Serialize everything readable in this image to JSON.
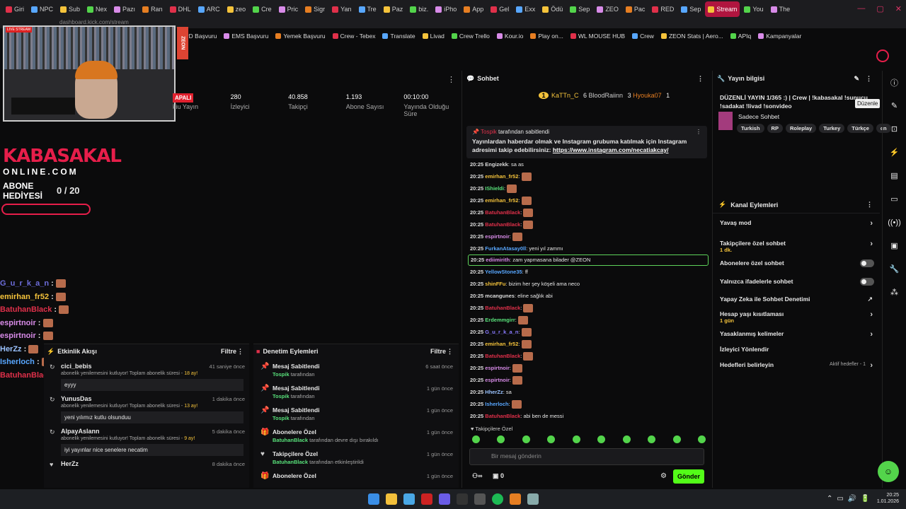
{
  "browser": {
    "tabs": [
      "Giri",
      "NPC",
      "Sub",
      "Nex",
      "Pazı",
      "Ran",
      "DHL",
      "ARC",
      "zeo",
      "Cre",
      "Pric",
      "Sigr",
      "Yan",
      "Tre",
      "Paz",
      "biz.",
      "iPho",
      "App",
      "Gel",
      "Exx",
      "Ödü",
      "Sep",
      "ZEO",
      "Pac",
      "RED",
      "Sep",
      "Stream",
      "You",
      "The"
    ],
    "active_tab": "Stream",
    "url": "dashboard.kick.com/stream"
  },
  "bookmarks": [
    "PD Başvuru",
    "EMS Başvuru",
    "Yemek Başvuru",
    "Crew - Tebex",
    "Translate",
    "Livad",
    "Crew Trello",
    "Kour.io",
    "Play on...",
    "WL MOUSE HUB",
    "Crew",
    "ZEON Stats | Aero...",
    "APIq",
    "Kampanyalar"
  ],
  "overlay": {
    "live_badge": "LIVE STREAM",
    "z_tag": "ZEON",
    "brand": "KABASAKAL",
    "brand_sub": "ONLINE.COM",
    "sub_goal_label": "ABONE HEDİYESİ",
    "sub_goal": "0 / 20",
    "sub_goal_fraction": 0,
    "chat": [
      {
        "user": "G_u_r_k_a_n",
        "color": "#6d6ddc"
      },
      {
        "user": "emirhan_fr52",
        "color": "#f5c33b"
      },
      {
        "user": "BatuhanBlack",
        "color": "#e0304a"
      },
      {
        "user": "espirtnoir",
        "color": "#d88be8"
      },
      {
        "user": "espirtnoir",
        "color": "#d88be8"
      },
      {
        "user": "HerZz",
        "color": "#9bc3ff"
      },
      {
        "user": "Isherloch",
        "color": "#58a7ff"
      },
      {
        "user": "BatuhanBlack",
        "color": "#e0304a"
      }
    ],
    "chat_msg": "abi ben de messi"
  },
  "stats": {
    "live": "APALI",
    "items": [
      {
        "v": "",
        "l": "kiu Yayın"
      },
      {
        "v": "280",
        "l": "İzleyici"
      },
      {
        "v": "40.858",
        "l": "Takipçi"
      },
      {
        "v": "1.193",
        "l": "Abone Sayısı"
      },
      {
        "v": "00:10:00",
        "l": "Yayında Olduğu Süre"
      }
    ]
  },
  "activity": {
    "title": "Etkinlik Akışı",
    "filter": "Filtre",
    "items": [
      {
        "name": "cici_bebis",
        "time": "41 saniye önce",
        "desc": "abonelik yenilemesini kutluyor! Toplam abonelik süresi - ",
        "months": "18 ay!",
        "msg": "eyyy"
      },
      {
        "name": "YunusDas",
        "time": "1 dakika önce",
        "desc": "abonelik yenilemesini kutluyor! Toplam abonelik süresi - ",
        "months": "13 ay!",
        "msg": "yeni yılımız kutlu olsunduu"
      },
      {
        "name": "AlpayAslann",
        "time": "5 dakika önce",
        "desc": "abonelik yenilemesini kutluyor! Toplam abonelik süresi - ",
        "months": "9 ay!",
        "msg": "iyi yayınlar nice senelere necatim"
      },
      {
        "name": "HerZz",
        "time": "8 dakika önce",
        "desc": "",
        "months": "",
        "msg": ""
      }
    ]
  },
  "moderation": {
    "title": "Denetim Eylemleri",
    "filter": "Filtre",
    "items": [
      {
        "name": "Mesaj Sabitlendi",
        "user": "Tospik",
        "rest": " tarafından",
        "time": "6 saat önce"
      },
      {
        "name": "Mesaj Sabitlendi",
        "user": "Tospik",
        "rest": " tarafından",
        "time": "1 gün önce"
      },
      {
        "name": "Mesaj Sabitlendi",
        "user": "Tospik",
        "rest": " tarafından",
        "time": "1 gün önce"
      },
      {
        "name": "Abonelere Özel",
        "user": "BatuhanBlack",
        "rest": " tarafından devre dışı bırakıldı",
        "time": "1 gün önce"
      },
      {
        "name": "Takipçilere Özel",
        "user": "BatuhanBlack",
        "rest": " tarafından etkinleştirildi",
        "time": "1 gün önce"
      },
      {
        "name": "Abonelere Özel",
        "user": "",
        "rest": "",
        "time": "1 gün önce"
      }
    ]
  },
  "chat": {
    "title": "Sohbet",
    "leaders": [
      {
        "name": "KaTTn_C",
        "n": "6"
      },
      {
        "name": "BloodRaiinn",
        "n": "3"
      },
      {
        "name": "Hyouka07",
        "n": "1"
      }
    ],
    "rank": "1",
    "pinned_by": "Tospik",
    "pinned_suffix": "tarafından sabitlendi",
    "pinned_text": "Yayınlardan haberdar olmak ve Instagram grubuma katılmak için Instagram adresimi takip edebilirsiniz: ",
    "pinned_link": "https://www.instagram.com/necatiakcay/",
    "messages": [
      {
        "t": "20:25",
        "u": "Engizekk",
        "c": "#ddd",
        "m": "sa as"
      },
      {
        "t": "20:25",
        "u": "emirhan_fr52",
        "c": "#f5c33b",
        "m": ""
      },
      {
        "t": "20:25",
        "u": "IShieldi",
        "c": "#58e17a",
        "m": ""
      },
      {
        "t": "20:25",
        "u": "emirhan_fr52",
        "c": "#f5c33b",
        "m": ""
      },
      {
        "t": "20:25",
        "u": "BatuhanBlack",
        "c": "#e0304a",
        "m": ""
      },
      {
        "t": "20:25",
        "u": "BatuhanBlack",
        "c": "#e0304a",
        "m": ""
      },
      {
        "t": "20:25",
        "u": "espirtnoir",
        "c": "#d88be8",
        "m": ""
      },
      {
        "t": "20:25",
        "u": "FurkanAtasay0ll",
        "c": "#58a7ff",
        "m": "yeni yıl zammı"
      },
      {
        "t": "20:25",
        "u": "ediimirith",
        "c": "#d88be8",
        "m": "zam yapmasana bilader @ZEON"
      },
      {
        "t": "20:25",
        "u": "YellowStone35",
        "c": "#58a7ff",
        "m": "ff"
      },
      {
        "t": "20:25",
        "u": "shinFFu",
        "c": "#f5c33b",
        "m": "bizim her şey köşeli ama neco"
      },
      {
        "t": "20:25",
        "u": "mcangunes",
        "c": "#ddd",
        "m": "eline sağlık abi"
      },
      {
        "t": "20:25",
        "u": "BatuhanBlack",
        "c": "#e0304a",
        "m": ""
      },
      {
        "t": "20:25",
        "u": "Erdemmgirr",
        "c": "#58e17a",
        "m": ""
      },
      {
        "t": "20:25",
        "u": "G_u_r_k_a_n",
        "c": "#8a7bff",
        "m": ""
      },
      {
        "t": "20:25",
        "u": "emirhan_fr52",
        "c": "#f5c33b",
        "m": ""
      },
      {
        "t": "20:25",
        "u": "BatuhanBlack",
        "c": "#e0304a",
        "m": ""
      },
      {
        "t": "20:25",
        "u": "espirtnoir",
        "c": "#d88be8",
        "m": ""
      },
      {
        "t": "20:25",
        "u": "espirtnoir",
        "c": "#d88be8",
        "m": ""
      },
      {
        "t": "20:25",
        "u": "HherZz",
        "c": "#9bc3ff",
        "m": "sa"
      },
      {
        "t": "20:25",
        "u": "Isherloch",
        "c": "#58a7ff",
        "m": ""
      },
      {
        "t": "20:25",
        "u": "BatuhanBlack",
        "c": "#e0304a",
        "m": "abi ben de messi"
      }
    ],
    "followers_only": "Takipçilere Özel",
    "placeholder": "Bir mesaj gönderin",
    "count": "0",
    "send": "Gönder"
  },
  "stream_info": {
    "title": "Yayın bilgisi",
    "stream_title": "DÜZENLİ YAYIN 1/365 :) | Crew | !kabasakal !sunucu !sadakat !livad !sonvideo",
    "category": "Sadece Sohbet",
    "tags": [
      "Turkish",
      "RP",
      "Roleplay",
      "Turkey",
      "Türkçe",
      "cn"
    ],
    "tooltip": "Düzenle"
  },
  "channel_actions": {
    "title": "Kanal Eylemleri",
    "items": [
      {
        "label": "Yavaş mod",
        "sub": "",
        "kind": "arrow"
      },
      {
        "label": "Takipçilere özel sohbet",
        "sub": "1 dk.",
        "kind": "arrow"
      },
      {
        "label": "Abonelere özel sohbet",
        "sub": "",
        "kind": "toggle"
      },
      {
        "label": "Yalnızca ifadelerle sohbet",
        "sub": "",
        "kind": "toggle"
      },
      {
        "label": "Yapay Zeka ile Sohbet Denetimi",
        "sub": "",
        "kind": "ext"
      },
      {
        "label": "Hesap yaşı kısıtlaması",
        "sub": "1 gün",
        "kind": "arrow"
      },
      {
        "label": "Yasaklanmış kelimeler",
        "sub": "",
        "kind": "arrow"
      },
      {
        "label": "İzleyici Yönlendir",
        "sub": "",
        "kind": "none"
      },
      {
        "label": "Hedefleri belirleyin",
        "sub": "",
        "kind": "arrow",
        "extra": "Aktif hedefler - 1"
      }
    ]
  },
  "taskbar": {
    "time": "20:25",
    "date": "1.01.2026"
  }
}
